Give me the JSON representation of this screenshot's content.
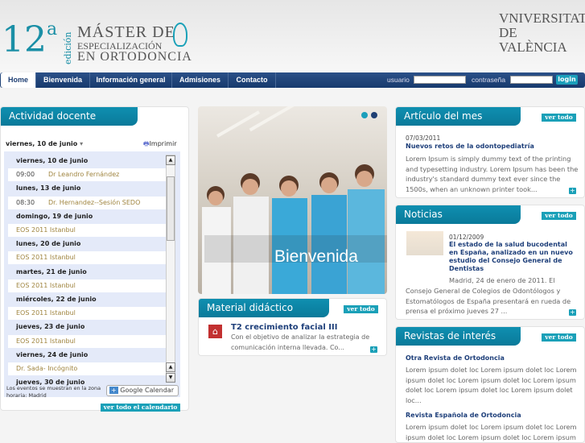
{
  "header": {
    "edition_number": "12",
    "edition_sup": "a",
    "edition_word": "edición",
    "master_line1": "MÁSTER DE",
    "master_line2": "ESPECIALIZACIÓN",
    "master_line3": "EN ORTODONCIA",
    "university_line1": "VNIVERSITAT",
    "university_line2": "DE VALÈNCIA"
  },
  "nav": {
    "tabs": [
      {
        "label": "Home"
      },
      {
        "label": "Bienvenida"
      },
      {
        "label": "Información general"
      },
      {
        "label": "Admisiones"
      },
      {
        "label": "Contacto"
      }
    ],
    "user_label": "usuario",
    "user_value": "",
    "pass_label": "contraseña",
    "pass_value": "",
    "login_label": "login"
  },
  "actividad": {
    "title": "Actividad docente",
    "current_date": "viernes, 10 de junio",
    "print_label": "Imprimir",
    "rows": [
      {
        "type": "day",
        "text": "viernes, 10 de junio"
      },
      {
        "type": "ev",
        "time": "09:00",
        "text": "Dr Leandro Fernández"
      },
      {
        "type": "day",
        "text": "lunes, 13 de junio"
      },
      {
        "type": "ev",
        "time": "08:30",
        "text": "Dr. Hernandez--Sesión SEDO"
      },
      {
        "type": "day",
        "text": "domingo, 19 de junio"
      },
      {
        "type": "ev",
        "time": "",
        "text": "EOS 2011 Istanbul"
      },
      {
        "type": "day",
        "text": "lunes, 20 de junio"
      },
      {
        "type": "ev",
        "time": "",
        "text": "EOS 2011 Istanbul"
      },
      {
        "type": "day",
        "text": "martes, 21 de junio"
      },
      {
        "type": "ev",
        "time": "",
        "text": "EOS 2011 Istanbul"
      },
      {
        "type": "day",
        "text": "miércoles, 22 de junio"
      },
      {
        "type": "ev",
        "time": "",
        "text": "EOS 2011 Istanbul"
      },
      {
        "type": "day",
        "text": "jueves, 23 de junio"
      },
      {
        "type": "ev",
        "time": "",
        "text": "EOS 2011 Istanbul"
      },
      {
        "type": "day",
        "text": "viernes, 24 de junio"
      },
      {
        "type": "ev",
        "time": "",
        "text": "Dr. Sada- Incógnito"
      },
      {
        "type": "day",
        "text": "jueves, 30 de junio"
      }
    ],
    "timezone_note": "Los eventos se muestran en la zona horaria: Madrid",
    "google_calendar": "Google Calendar",
    "see_all": "ver todo el calendario"
  },
  "slider": {
    "caption": "Bienvenida"
  },
  "material": {
    "title": "Material didáctico",
    "see_all": "ver todo",
    "item_title": "T2 crecimiento facial III",
    "item_body": "Con el objetivo de analizar la estrategia de comunicación interna llevada. Co..."
  },
  "articulo": {
    "title": "Artículo del mes",
    "see_all": "ver todo",
    "date": "07/03/2011",
    "item_title": "Nuevos retos de la odontopediatría",
    "body": "Lorem Ipsum is simply dummy text of the printing and typesetting industry. Lorem Ipsum has been the industry's standard dummy text ever since the 1500s, when an unknown printer took..."
  },
  "noticias": {
    "title": "Noticias",
    "see_all": "ver todo",
    "date": "01/12/2009",
    "item_title": "El estado de la salud bucodental en España, analizado en un nuevo estudio del Consejo General de Dentistas",
    "body_first": "Madrid, 24 de enero de 2011. El",
    "body_rest": "Consejo General de Colegios de Odontólogos y Estomatólogos de España presentará en rueda de prensa el próximo jueves 27 ..."
  },
  "revistas": {
    "title": "Revistas de interés",
    "see_all": "ver todo",
    "items": [
      {
        "title": "Otra Revista de Ortodoncia",
        "body": "Lorem ipsum dolet loc Lorem ipsum dolet loc Lorem ipsum dolet loc Lorem ipsum dolet loc Lorem ipsum dolet loc Lorem ipsum dolet loc Lorem ipsum dolet loc..."
      },
      {
        "title": "Revista Española de Ortodoncia",
        "body": "Lorem ipsum dolet loc Lorem ipsum dolet loc Lorem ipsum dolet loc Lorem ipsum dolet loc Lorem ipsum"
      }
    ]
  }
}
